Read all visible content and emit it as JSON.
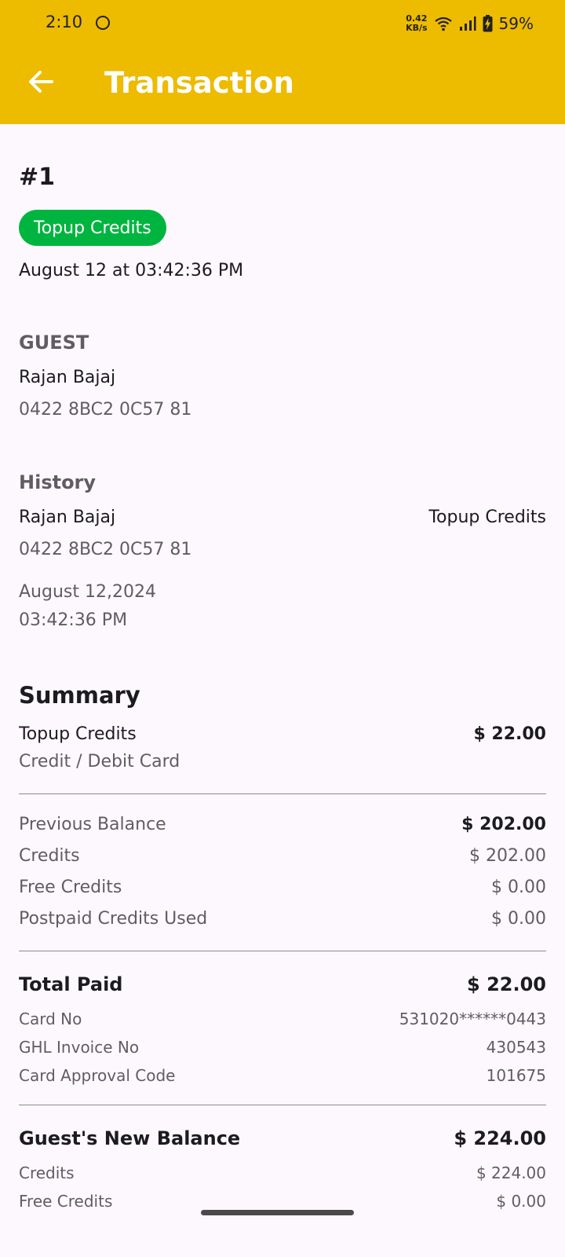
{
  "status_bar": {
    "time": "2:10",
    "net_speed_value": "0.42",
    "net_speed_unit": "KB/s",
    "battery": "59%"
  },
  "app_bar": {
    "title": "Transaction",
    "back_icon": "arrow-left-icon"
  },
  "colors": {
    "app_bar": "#edbb00",
    "badge": "#00b53f",
    "background": "#fdf8fd"
  },
  "transaction": {
    "id": "#1",
    "type_badge": "Topup Credits",
    "datetime": "August 12 at 03:42:36 PM"
  },
  "guest": {
    "heading": "GUEST",
    "name": "Rajan Bajaj",
    "card_id": "0422 8BC2 0C57 81"
  },
  "history": {
    "heading": "History",
    "name": "Rajan Bajaj",
    "type": "Topup Credits",
    "card_id": "0422 8BC2 0C57 81",
    "date": "August 12,2024",
    "time": "03:42:36 PM"
  },
  "summary": {
    "heading": "Summary",
    "item": {
      "label": "Topup Credits",
      "amount": "$ 22.00",
      "method": "Credit / Debit Card"
    },
    "previous_balance": {
      "label": "Previous Balance",
      "amount": "$ 202.00",
      "rows": [
        {
          "label": "Credits",
          "value": "$ 202.00"
        },
        {
          "label": "Free Credits",
          "value": "$ 0.00"
        },
        {
          "label": "Postpaid Credits Used",
          "value": "$ 0.00"
        }
      ]
    },
    "total_paid": {
      "label": "Total Paid",
      "amount": "$ 22.00",
      "rows": [
        {
          "label": "Card No",
          "value": "531020******0443"
        },
        {
          "label": "GHL Invoice No",
          "value": "430543"
        },
        {
          "label": "Card Approval Code",
          "value": "101675"
        }
      ]
    },
    "new_balance": {
      "label": "Guest's New Balance",
      "amount": "$ 224.00",
      "rows": [
        {
          "label": "Credits",
          "value": "$ 224.00"
        },
        {
          "label": "Free Credits",
          "value": "$ 0.00"
        }
      ]
    }
  }
}
